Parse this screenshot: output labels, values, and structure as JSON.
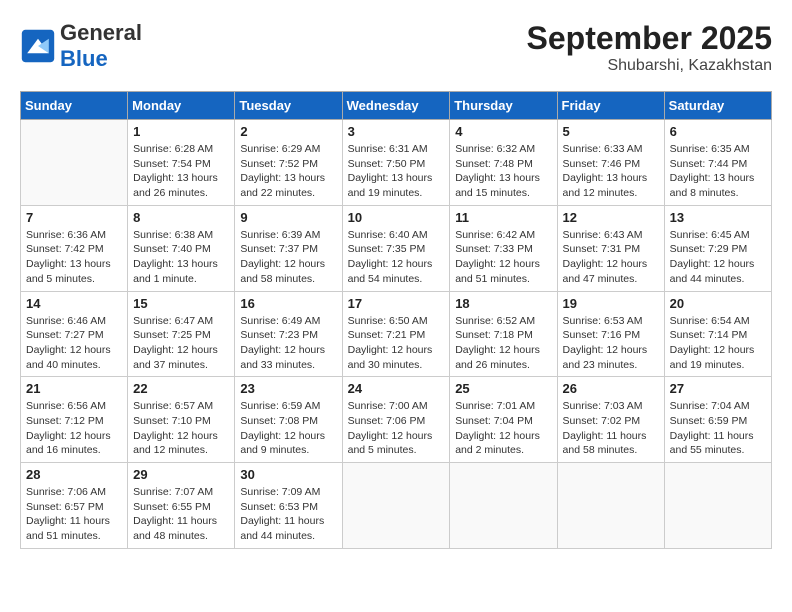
{
  "logo": {
    "general": "General",
    "blue": "Blue"
  },
  "title": "September 2025",
  "subtitle": "Shubarshi, Kazakhstan",
  "days_of_week": [
    "Sunday",
    "Monday",
    "Tuesday",
    "Wednesday",
    "Thursday",
    "Friday",
    "Saturday"
  ],
  "weeks": [
    [
      {
        "day": "",
        "sunrise": "",
        "sunset": "",
        "daylight": ""
      },
      {
        "day": "1",
        "sunrise": "Sunrise: 6:28 AM",
        "sunset": "Sunset: 7:54 PM",
        "daylight": "Daylight: 13 hours and 26 minutes."
      },
      {
        "day": "2",
        "sunrise": "Sunrise: 6:29 AM",
        "sunset": "Sunset: 7:52 PM",
        "daylight": "Daylight: 13 hours and 22 minutes."
      },
      {
        "day": "3",
        "sunrise": "Sunrise: 6:31 AM",
        "sunset": "Sunset: 7:50 PM",
        "daylight": "Daylight: 13 hours and 19 minutes."
      },
      {
        "day": "4",
        "sunrise": "Sunrise: 6:32 AM",
        "sunset": "Sunset: 7:48 PM",
        "daylight": "Daylight: 13 hours and 15 minutes."
      },
      {
        "day": "5",
        "sunrise": "Sunrise: 6:33 AM",
        "sunset": "Sunset: 7:46 PM",
        "daylight": "Daylight: 13 hours and 12 minutes."
      },
      {
        "day": "6",
        "sunrise": "Sunrise: 6:35 AM",
        "sunset": "Sunset: 7:44 PM",
        "daylight": "Daylight: 13 hours and 8 minutes."
      }
    ],
    [
      {
        "day": "7",
        "sunrise": "Sunrise: 6:36 AM",
        "sunset": "Sunset: 7:42 PM",
        "daylight": "Daylight: 13 hours and 5 minutes."
      },
      {
        "day": "8",
        "sunrise": "Sunrise: 6:38 AM",
        "sunset": "Sunset: 7:40 PM",
        "daylight": "Daylight: 13 hours and 1 minute."
      },
      {
        "day": "9",
        "sunrise": "Sunrise: 6:39 AM",
        "sunset": "Sunset: 7:37 PM",
        "daylight": "Daylight: 12 hours and 58 minutes."
      },
      {
        "day": "10",
        "sunrise": "Sunrise: 6:40 AM",
        "sunset": "Sunset: 7:35 PM",
        "daylight": "Daylight: 12 hours and 54 minutes."
      },
      {
        "day": "11",
        "sunrise": "Sunrise: 6:42 AM",
        "sunset": "Sunset: 7:33 PM",
        "daylight": "Daylight: 12 hours and 51 minutes."
      },
      {
        "day": "12",
        "sunrise": "Sunrise: 6:43 AM",
        "sunset": "Sunset: 7:31 PM",
        "daylight": "Daylight: 12 hours and 47 minutes."
      },
      {
        "day": "13",
        "sunrise": "Sunrise: 6:45 AM",
        "sunset": "Sunset: 7:29 PM",
        "daylight": "Daylight: 12 hours and 44 minutes."
      }
    ],
    [
      {
        "day": "14",
        "sunrise": "Sunrise: 6:46 AM",
        "sunset": "Sunset: 7:27 PM",
        "daylight": "Daylight: 12 hours and 40 minutes."
      },
      {
        "day": "15",
        "sunrise": "Sunrise: 6:47 AM",
        "sunset": "Sunset: 7:25 PM",
        "daylight": "Daylight: 12 hours and 37 minutes."
      },
      {
        "day": "16",
        "sunrise": "Sunrise: 6:49 AM",
        "sunset": "Sunset: 7:23 PM",
        "daylight": "Daylight: 12 hours and 33 minutes."
      },
      {
        "day": "17",
        "sunrise": "Sunrise: 6:50 AM",
        "sunset": "Sunset: 7:21 PM",
        "daylight": "Daylight: 12 hours and 30 minutes."
      },
      {
        "day": "18",
        "sunrise": "Sunrise: 6:52 AM",
        "sunset": "Sunset: 7:18 PM",
        "daylight": "Daylight: 12 hours and 26 minutes."
      },
      {
        "day": "19",
        "sunrise": "Sunrise: 6:53 AM",
        "sunset": "Sunset: 7:16 PM",
        "daylight": "Daylight: 12 hours and 23 minutes."
      },
      {
        "day": "20",
        "sunrise": "Sunrise: 6:54 AM",
        "sunset": "Sunset: 7:14 PM",
        "daylight": "Daylight: 12 hours and 19 minutes."
      }
    ],
    [
      {
        "day": "21",
        "sunrise": "Sunrise: 6:56 AM",
        "sunset": "Sunset: 7:12 PM",
        "daylight": "Daylight: 12 hours and 16 minutes."
      },
      {
        "day": "22",
        "sunrise": "Sunrise: 6:57 AM",
        "sunset": "Sunset: 7:10 PM",
        "daylight": "Daylight: 12 hours and 12 minutes."
      },
      {
        "day": "23",
        "sunrise": "Sunrise: 6:59 AM",
        "sunset": "Sunset: 7:08 PM",
        "daylight": "Daylight: 12 hours and 9 minutes."
      },
      {
        "day": "24",
        "sunrise": "Sunrise: 7:00 AM",
        "sunset": "Sunset: 7:06 PM",
        "daylight": "Daylight: 12 hours and 5 minutes."
      },
      {
        "day": "25",
        "sunrise": "Sunrise: 7:01 AM",
        "sunset": "Sunset: 7:04 PM",
        "daylight": "Daylight: 12 hours and 2 minutes."
      },
      {
        "day": "26",
        "sunrise": "Sunrise: 7:03 AM",
        "sunset": "Sunset: 7:02 PM",
        "daylight": "Daylight: 11 hours and 58 minutes."
      },
      {
        "day": "27",
        "sunrise": "Sunrise: 7:04 AM",
        "sunset": "Sunset: 6:59 PM",
        "daylight": "Daylight: 11 hours and 55 minutes."
      }
    ],
    [
      {
        "day": "28",
        "sunrise": "Sunrise: 7:06 AM",
        "sunset": "Sunset: 6:57 PM",
        "daylight": "Daylight: 11 hours and 51 minutes."
      },
      {
        "day": "29",
        "sunrise": "Sunrise: 7:07 AM",
        "sunset": "Sunset: 6:55 PM",
        "daylight": "Daylight: 11 hours and 48 minutes."
      },
      {
        "day": "30",
        "sunrise": "Sunrise: 7:09 AM",
        "sunset": "Sunset: 6:53 PM",
        "daylight": "Daylight: 11 hours and 44 minutes."
      },
      {
        "day": "",
        "sunrise": "",
        "sunset": "",
        "daylight": ""
      },
      {
        "day": "",
        "sunrise": "",
        "sunset": "",
        "daylight": ""
      },
      {
        "day": "",
        "sunrise": "",
        "sunset": "",
        "daylight": ""
      },
      {
        "day": "",
        "sunrise": "",
        "sunset": "",
        "daylight": ""
      }
    ]
  ]
}
